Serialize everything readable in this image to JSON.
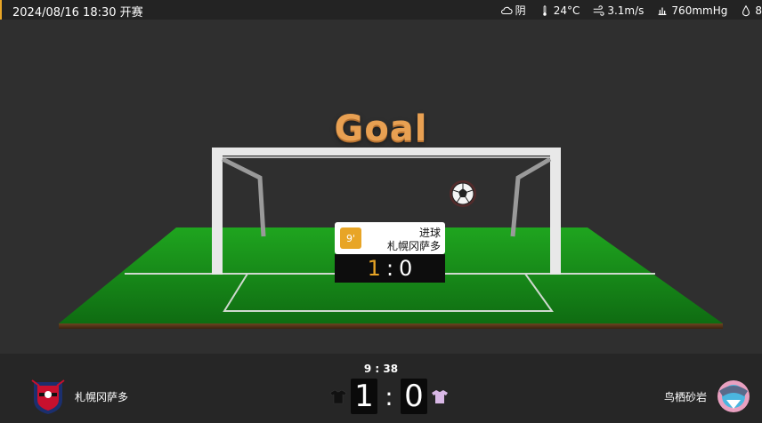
{
  "header": {
    "datetime": "2024/08/16 18:30 开赛",
    "weather": {
      "condition": "阴",
      "temperature": "24°C",
      "wind": "3.1m/s",
      "pressure": "760mmHg",
      "humidity": "8"
    }
  },
  "stage": {
    "title": "Goal",
    "event": {
      "minute": "9'",
      "type": "进球",
      "team": "札幌冈萨多"
    },
    "score": {
      "home": "1",
      "separator": ":",
      "away": "0"
    }
  },
  "footer": {
    "clock": "9 : 38",
    "home_team": "札幌冈萨多",
    "away_team": "鸟栖砂岩",
    "score": {
      "home": "1",
      "separator": ":",
      "away": "0"
    },
    "home_shirt_color": "#111111",
    "away_shirt_color": "#d9b8e6"
  },
  "colors": {
    "accent": "#e8a526",
    "pitch": "#1e8f1e",
    "title": "#e8a052"
  }
}
